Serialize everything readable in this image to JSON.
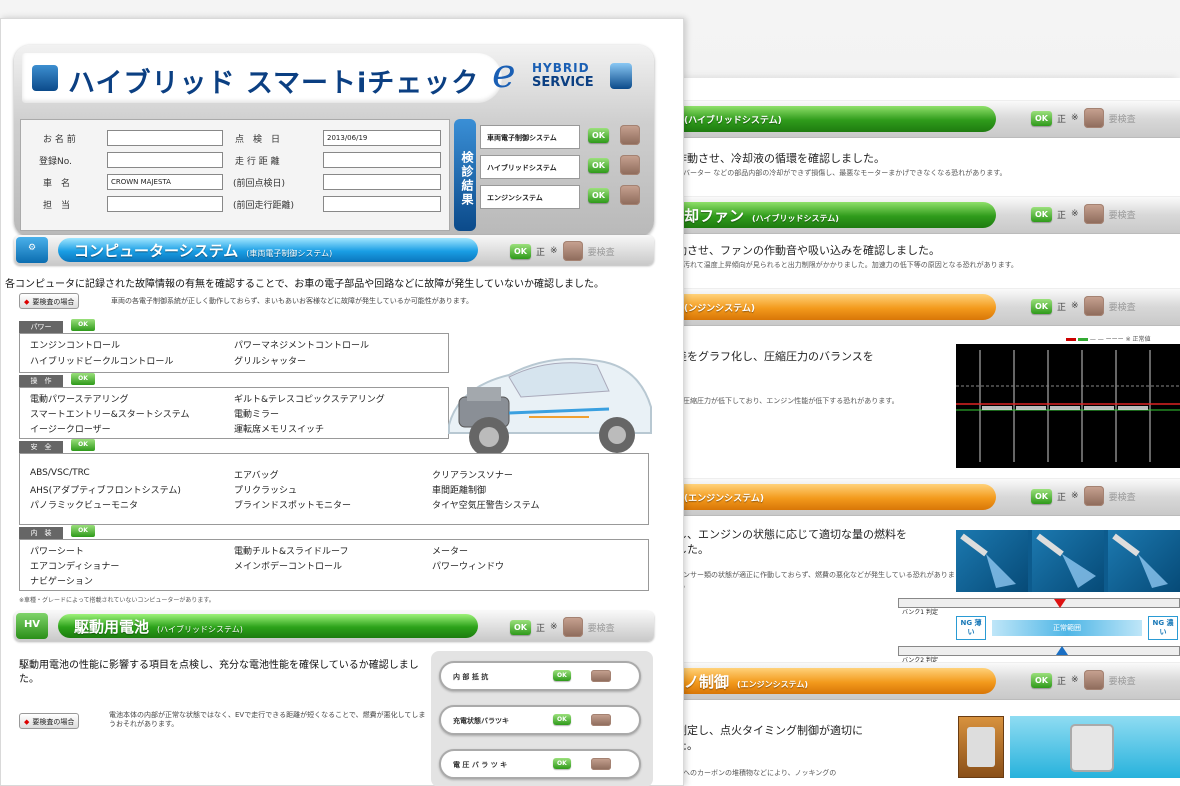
{
  "back": {
    "sections": [
      {
        "bar": "(ハイブリッドシステム)",
        "heading": "作動させ、冷却液の循環を確認しました。",
        "note": "ンバーター などの部品内部の冷却ができず損傷し、最悪なモーターまかげできなくなる恐れがあります。"
      },
      {
        "bar": "却ファン",
        "bar_sub": "(ハイブリッドシステム)",
        "heading": "動させ、ファンの作動音や吸い込みを確認しました。",
        "note": "が汚れて温度上昇傾向が見られると出力制限がかかりました。加速力の低下等の原因となる恐れがあります。"
      },
      {
        "bar": "(ンジンシステム)",
        "heading": "差をグラフ化し、圧縮圧力のバランスを",
        "note": "の圧縮圧力が低下しており、エンジン性能が低下する恐れがあります。",
        "legend": "— — ーーー ※ 正常値"
      },
      {
        "bar": "(エンジンシステム)",
        "heading": "し、エンジンの状態に応じて適切な量の燃料を",
        "heading2": "した。",
        "note": "センサー類の状態が適正に作動しておらず、燃費の悪化などが発生している恐れがあります。",
        "scale_top": "バンク1 判定",
        "scale_bottom": "バンク2 判定",
        "ng_left": "NG 薄い",
        "ng_mid": "正常範囲",
        "ng_right": "NG 濃い"
      },
      {
        "bar": "ノ制御",
        "bar_sub": "(エンジンシステム)",
        "heading": "測定し、点火タイミング制御が適切に",
        "heading2": "た。",
        "note": "室へのカーボンの堆積物などにより、ノッキングの"
      }
    ],
    "status": {
      "ok": "OK",
      "ok_mark": "正",
      "warn_mark": "※",
      "reinspect": "要検査"
    }
  },
  "front": {
    "title": "ハイブリッド スマートiチェック",
    "logo_e": "e",
    "logo_top": "HYBRID",
    "logo_bottom": "SERVICE",
    "form": {
      "name_label": "お 名 前",
      "name_value": "",
      "reg_label": "登録No.",
      "reg_value": "",
      "car_label": "車　名",
      "car_value": "CROWN MAJESTA",
      "staff_label": "担　当",
      "staff_value": "",
      "date_label": "点　検　日",
      "date_value": "2013/06/19",
      "mileage_label": "走 行 距 離",
      "mileage_value": "",
      "prev_date_label": "(前回点検日)",
      "prev_date_value": "",
      "prev_mileage_label": "(前回走行距離)",
      "prev_mileage_value": ""
    },
    "result_label": "検診結果",
    "systems": [
      {
        "name": "車両電子制御システム",
        "status": "OK"
      },
      {
        "name": "ハイブリッドシステム",
        "status": "OK"
      },
      {
        "name": "エンジンシステム",
        "status": "OK"
      }
    ],
    "computer": {
      "title": "コンピューターシステム",
      "sub": "(車両電子制御システム)",
      "desc": "各コンピュータに記録された故障情報の有無を確認することで、お車の電子部品や回路などに故障が発生していないか確認しました。",
      "reinspect_btn": "要検査の場合",
      "reinspect_note": "車両の各電子制御系統が正しく動作しておらず、まいもあいお客様などに故障が発生しているか可能性があります。",
      "categories": [
        {
          "label": "パワー",
          "ok": "OK",
          "items": [
            "エンジンコントロール",
            "パワーマネジメントコントロール",
            "ハイブリッドビークルコントロール",
            "グリルシャッター"
          ]
        },
        {
          "label": "操　作",
          "ok": "OK",
          "items": [
            "電動パワーステアリング",
            "ギルト&テレスコピックステアリング",
            "スマートエントリー&スタートシステム",
            "電動ミラー",
            "イージークローザー",
            "運転席メモリスイッチ"
          ]
        },
        {
          "label": "安　全",
          "ok": "OK",
          "items": [
            "ABS/VSC/TRC",
            "エアバッグ",
            "クリアランスソナー",
            "AHS(アダプティブフロントシステム)",
            "プリクラッシュ",
            "車間距離制御",
            "パノラミックビューモニタ",
            "ブラインドスポットモニター",
            "タイヤ空気圧警告システム"
          ]
        },
        {
          "label": "内　装",
          "ok": "OK",
          "items": [
            "パワーシート",
            "電動チルト&スライドルーフ",
            "メーター",
            "エアコンディショナー",
            "メインボデーコントロール",
            "パワーウィンドウ",
            "ナビゲーション"
          ]
        }
      ],
      "footnote": "※車種・グレードによって搭載されていないコンピューターがあります。"
    },
    "battery": {
      "title": "駆動用電池",
      "sub": "(ハイブリッドシステム)",
      "icon": "HV",
      "desc": "駆動用電池の性能に影響する項目を点検し、充分な電池性能を確保しているか確認しました。",
      "reinspect_btn": "要検査の場合",
      "reinspect_note": "電池本体の内部が正常な状態ではなく、EVで走行できる距離が短くなることで、燃費が悪化してしまうおそれがあります。",
      "rows": [
        {
          "label": "内 部 抵 抗",
          "status": "OK"
        },
        {
          "label": "充電状態バラツキ",
          "status": "OK"
        },
        {
          "label": "電 圧 バ ラ ツ キ",
          "status": "OK"
        }
      ]
    },
    "status": {
      "ok": "OK",
      "ok_mark": "正",
      "warn_mark": "※",
      "reinspect": "要検査"
    }
  },
  "colors": {
    "green": "#2e9a1a",
    "blue": "#1a9ee4",
    "orange": "#f39a1c",
    "brown": "#8c6a5a",
    "navy": "#0b4a8a"
  }
}
